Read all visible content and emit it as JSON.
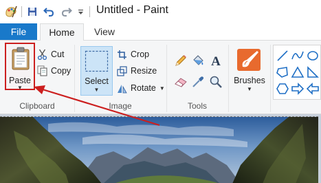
{
  "window": {
    "title": "Untitled - Paint"
  },
  "tabs": {
    "file": "File",
    "home": "Home",
    "view": "View"
  },
  "clipboard": {
    "paste_label": "Paste",
    "cut_label": "Cut",
    "copy_label": "Copy",
    "group_label": "Clipboard"
  },
  "image": {
    "select_label": "Select",
    "crop_label": "Crop",
    "resize_label": "Resize",
    "rotate_label": "Rotate",
    "group_label": "Image"
  },
  "tools": {
    "group_label": "Tools",
    "items": [
      "pencil-icon",
      "fill-bucket-icon",
      "text-icon",
      "eraser-icon",
      "color-picker-icon",
      "magnifier-icon"
    ]
  },
  "brushes": {
    "label": "Brushes"
  },
  "shapes": {
    "items": [
      "line-shape-icon",
      "curve-shape-icon",
      "oval-shape-icon",
      "polygon-shape-icon",
      "triangle-shape-icon",
      "right-triangle-shape-icon",
      "hexagon-shape-icon",
      "right-arrow-shape-icon",
      "left-arrow-shape-icon"
    ]
  },
  "colors": {
    "file_tab": "#1979ca",
    "highlight_box": "#cc1f1f",
    "select_active": "#cce4f7",
    "shape_stroke": "#1f6fc5"
  }
}
